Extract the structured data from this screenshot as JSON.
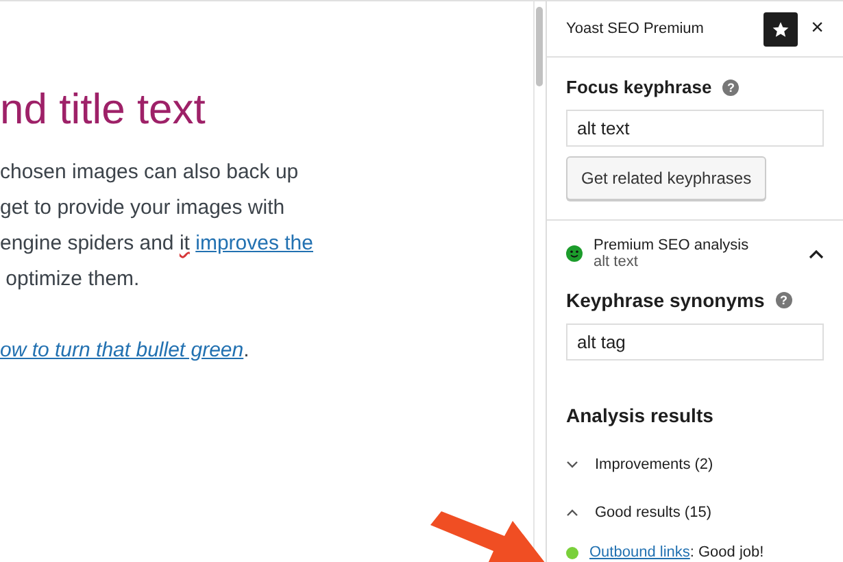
{
  "editor": {
    "title": "nd title text",
    "lines": [
      [
        {
          "kind": "plain",
          "text": "chosen images can also back up"
        }
      ],
      [
        {
          "kind": "plain",
          "text": "get to provide your images with"
        }
      ],
      [
        {
          "kind": "plain",
          "text": "engine spiders and "
        },
        {
          "kind": "misspelled",
          "text": "it"
        },
        {
          "kind": "link",
          "text": "improves the",
          "gap_before": true
        }
      ],
      [
        {
          "kind": "plain",
          "text": " optimize them."
        }
      ]
    ],
    "link_line": {
      "link": "ow to turn that bullet green",
      "after": "."
    }
  },
  "sidebar": {
    "title": "Yoast SEO Premium",
    "star_pinned": true,
    "close": "×",
    "focus": {
      "label": "Focus keyphrase",
      "help": "?",
      "value": "alt text",
      "button": "Get related keyphrases"
    },
    "analysis": {
      "title": "Premium SEO analysis",
      "subtitle": "alt text",
      "expanded": true,
      "synonyms": {
        "label": "Keyphrase synonyms",
        "help": "?",
        "value": "alt tag"
      },
      "results_heading": "Analysis results",
      "groups": [
        {
          "label": "Improvements (2)",
          "expanded": false
        },
        {
          "label": "Good results (15)",
          "expanded": true
        }
      ],
      "results": [
        {
          "link": "Outbound links",
          "text": ": Good job!",
          "color": "#7ad03a"
        }
      ]
    }
  }
}
